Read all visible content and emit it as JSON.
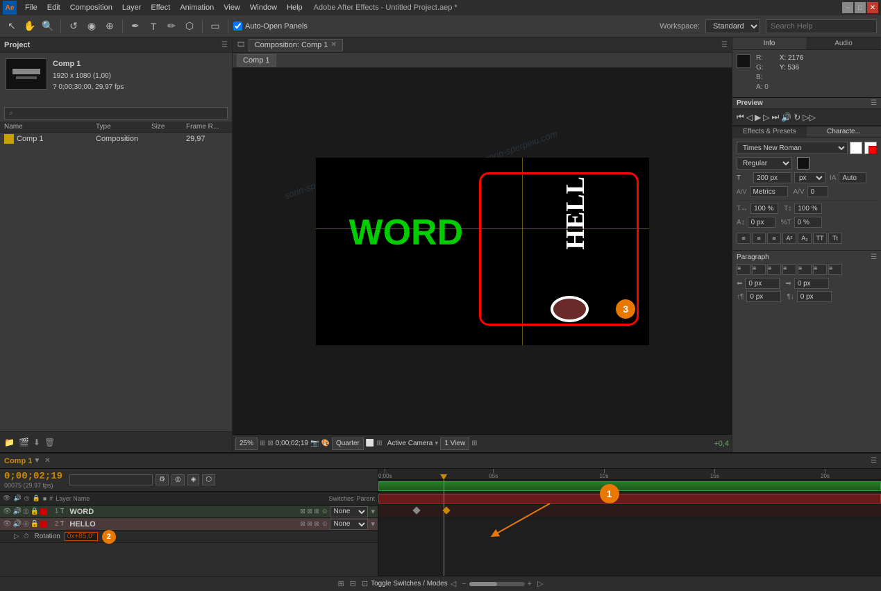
{
  "app": {
    "title": "Adobe After Effects - Untitled Project.aep *",
    "logo": "Ae"
  },
  "menubar": {
    "items": [
      "File",
      "Edit",
      "Composition",
      "Layer",
      "Effect",
      "Animation",
      "View",
      "Window",
      "Help"
    ]
  },
  "toolbar": {
    "workspace_label": "Workspace:",
    "workspace_value": "Standard",
    "auto_open_label": "Auto-Open Panels",
    "search_placeholder": "Search Help"
  },
  "project": {
    "panel_title": "Project",
    "comp_name": "Comp 1",
    "comp_details": "1920 x 1080 (1,00)",
    "comp_duration": "? 0;00;30;00, 29,97 fps",
    "search_placeholder": "⌕",
    "table_headers": [
      "Name",
      "Type",
      "Size",
      "Frame R..."
    ],
    "items": [
      {
        "name": "Comp 1",
        "type": "Composition",
        "size": "",
        "framerate": "29,97"
      }
    ]
  },
  "composition": {
    "panel_title": "Composition: Comp 1",
    "tab_label": "Comp 1",
    "zoom": "25%",
    "time": "0;00;02;19",
    "quality": "Quarter",
    "active_camera": "Active Camera",
    "view": "1 View"
  },
  "info_panel": {
    "tab_info": "Info",
    "tab_audio": "Audio",
    "r": "R:",
    "g": "G:",
    "b": "B:",
    "a": "A: 0",
    "x": "X: 2176",
    "y": "Y: 536"
  },
  "preview_panel": {
    "tab_label": "Preview"
  },
  "effects_panel": {
    "tab_effects": "Effects & Presets",
    "tab_character": "Characte..."
  },
  "character": {
    "font": "Times New Roman",
    "style": "Regular",
    "size": "200 px",
    "size_auto": "Auto",
    "metrics": "Metrics",
    "tracking": "0",
    "leading": "0",
    "kerning": "0 %",
    "scale_h": "100 %",
    "scale_v": "100 %",
    "baseline": "0 px",
    "tsume": "0 px",
    "unit": "px"
  },
  "paragraph": {
    "title": "Paragraph",
    "indent_left": "0 px",
    "indent_right": "0 px",
    "indent_top": "0 px",
    "space_before": "0 px",
    "space_after": "0 px"
  },
  "timeline": {
    "comp_name": "Comp 1",
    "time": "0;00;02;19",
    "fps": "00075 (29.97 fps)",
    "layers": [
      {
        "num": "1",
        "name": "WORD",
        "type": "T",
        "parent": "None",
        "color": "#cc0000"
      },
      {
        "num": "2",
        "name": "HELLO",
        "type": "T",
        "parent": "None",
        "color": "#cc0000"
      }
    ],
    "rotation_prop": "Rotation",
    "rotation_val": "0x+85,0°",
    "time_markers": [
      "0;00s",
      "05s",
      "10s",
      "15s",
      "20s"
    ]
  },
  "bottom_bar": {
    "toggle_label": "Toggle Switches / Modes"
  },
  "annotations": {
    "circle1": "1",
    "circle2": "2",
    "circle3": "3"
  }
}
